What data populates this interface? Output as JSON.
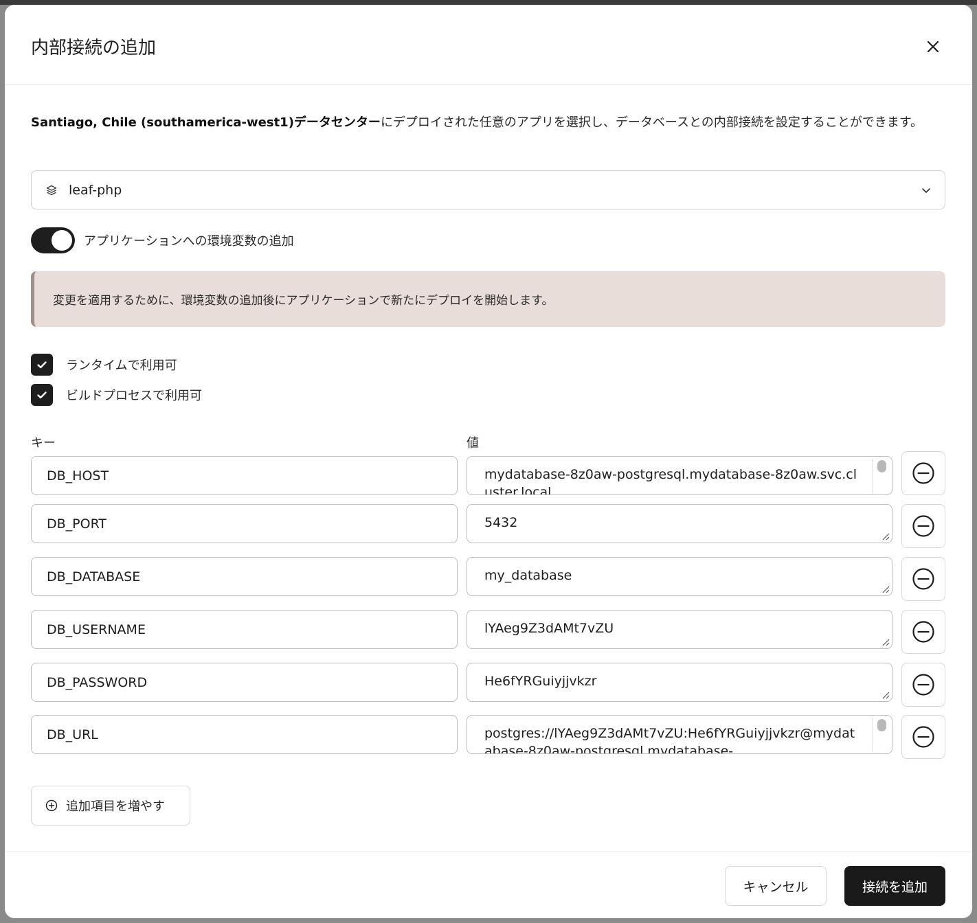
{
  "dialog": {
    "title": "内部接続の追加",
    "close_icon": "close-icon"
  },
  "description": {
    "bold": "Santiago, Chile (southamerica-west1)データセンター",
    "rest": "にデプロイされた任意のアプリを選択し、データベースとの内部接続を設定することができます。"
  },
  "app_select": {
    "icon": "stack-icon",
    "value": "leaf-php",
    "chevron": "chevron-down-icon"
  },
  "env_toggle": {
    "label": "アプリケーションへの環境変数の追加",
    "on": true
  },
  "notice": {
    "text": "変更を適用するために、環境変数の追加後にアプリケーションで新たにデプロイを開始します。"
  },
  "options": {
    "runtime_label": "ランタイムで利用可",
    "runtime_checked": true,
    "build_label": "ビルドプロセスで利用可",
    "build_checked": true
  },
  "env_table": {
    "key_header": "キー",
    "value_header": "値",
    "rows": [
      {
        "key": "DB_HOST",
        "value": "mydatabase-8z0aw-postgresql.mydatabase-8z0aw.svc.cluster.local"
      },
      {
        "key": "DB_PORT",
        "value": "5432"
      },
      {
        "key": "DB_DATABASE",
        "value": "my_database"
      },
      {
        "key": "DB_USERNAME",
        "value": "lYAeg9Z3dAMt7vZU"
      },
      {
        "key": "DB_PASSWORD",
        "value": "He6fYRGuiyjjvkzr"
      },
      {
        "key": "DB_URL",
        "value": "postgres://lYAeg9Z3dAMt7vZU:He6fYRGuiyjjvkzr@mydatabase-8z0aw-postgresql.mydatabase-"
      }
    ]
  },
  "add_more": {
    "label": "追加項目を増やす",
    "icon": "plus-circle-icon"
  },
  "footer": {
    "cancel_label": "キャンセル",
    "submit_label": "接続を追加"
  },
  "colors": {
    "primary": "#1a1a1a",
    "notice_bg": "#e8ddd9",
    "notice_border": "#a28e88"
  }
}
